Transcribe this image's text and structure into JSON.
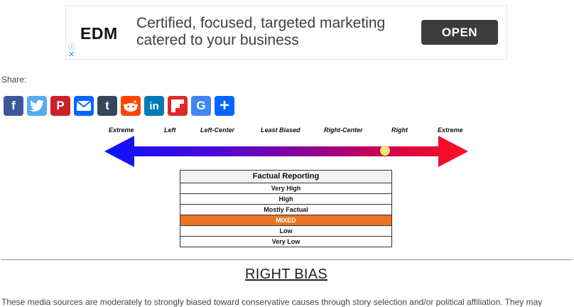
{
  "ad": {
    "logo": "EDM",
    "text": "Certified, focused, targeted marketing catered to your business",
    "open_label": "OPEN",
    "info_icon": "info-icon",
    "close_icon": "close-icon"
  },
  "share": {
    "label": "Share:",
    "buttons": [
      {
        "name": "facebook",
        "glyph": "f",
        "color": "#3b5998"
      },
      {
        "name": "twitter",
        "glyph": "t",
        "color": "#55acee"
      },
      {
        "name": "pinterest",
        "glyph": "P",
        "color": "#cb2027"
      },
      {
        "name": "email",
        "glyph": "✉",
        "color": "#0166ff"
      },
      {
        "name": "tumblr",
        "glyph": "t",
        "color": "#35465c"
      },
      {
        "name": "reddit",
        "glyph": "r",
        "color": "#ff4500"
      },
      {
        "name": "linkedin",
        "glyph": "in",
        "color": "#007bb5"
      },
      {
        "name": "flipboard",
        "glyph": "f",
        "color": "#e12828"
      },
      {
        "name": "google",
        "glyph": "G",
        "color": "#4285f4"
      },
      {
        "name": "share-more",
        "glyph": "+",
        "color": "#0166ff"
      }
    ]
  },
  "bias_scale": {
    "labels": [
      "Extreme",
      "Left",
      "Left-Center",
      "Least Biased",
      "Right-Center",
      "Right",
      "Extreme"
    ],
    "marker_position": "Right",
    "marker_color": "#f3e77a"
  },
  "factual_reporting": {
    "title": "Factual Reporting",
    "levels": [
      "Very High",
      "High",
      "Mostly Factual",
      "MIXED",
      "Low",
      "Very Low"
    ],
    "selected": "MIXED",
    "selected_color": "#e97524"
  },
  "bias_title": "RIGHT BIAS",
  "description": "These media sources are moderately to strongly biased toward conservative causes through story selection and/or political affiliation. They may"
}
